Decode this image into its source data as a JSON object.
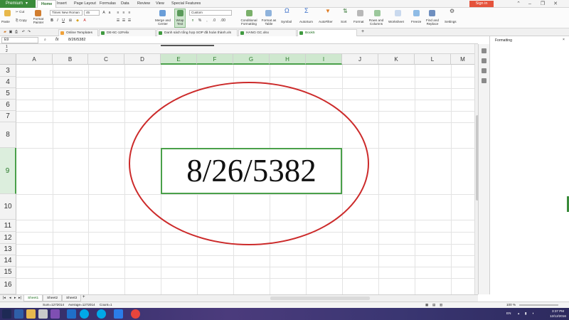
{
  "app": {
    "premium_label": "Premium",
    "menu_tabs": [
      "Home",
      "Insert",
      "Page Layout",
      "Formulas",
      "Data",
      "Review",
      "View",
      "Special Features"
    ],
    "signin_label": "Sign in"
  },
  "ribbon": {
    "cut": "Cut",
    "copy": "Copy",
    "paste": "Paste",
    "format_painter": "Format Painter",
    "font_name": "Times New Roman",
    "font_size": "45",
    "merge_center": "Merge and Center",
    "wrap_text": "Wrap Text",
    "number_format": "Custom",
    "conditional_formatting": "Conditional Formatting",
    "format_as_table": "Format as Table",
    "symbol": "Symbol",
    "autosum": "AutoSum",
    "autofilter": "AutoFilter",
    "sort": "Sort",
    "format": "Format",
    "rows_columns": "Rows and Columns",
    "worksheet": "Worksheet",
    "freeze": "Freeze",
    "find_replace": "Find and Replace",
    "settings": "Settings"
  },
  "doc_tabs": [
    {
      "label": "Online Templates",
      "type": "web"
    },
    {
      "label": "DE-6C-12Felix",
      "type": "sheet"
    },
    {
      "label": "Danh sách tổng hợp SOP đã hoàn thành.xls",
      "type": "sheet"
    },
    {
      "label": "HANG GC.xlsx",
      "type": "sheet"
    },
    {
      "label": "Book5",
      "type": "sheet"
    }
  ],
  "formula_bar": {
    "name_box": "E9",
    "fx": "fx",
    "value": "8/26/5382"
  },
  "grid": {
    "columns": [
      "A",
      "B",
      "C",
      "D",
      "E",
      "F",
      "G",
      "H",
      "I",
      "J",
      "K",
      "L",
      "M"
    ],
    "rows": [
      "3",
      "4",
      "5",
      "6",
      "7",
      "8",
      "9",
      "10",
      "11",
      "12",
      "13",
      "14",
      "15",
      "16"
    ],
    "selected_row": "9",
    "selected_cols": [
      "E",
      "F",
      "G",
      "H",
      "I"
    ],
    "cell_value": "8/26/5382",
    "outline_levels": [
      "1",
      "2"
    ]
  },
  "right_panel": {
    "title": "Formatting"
  },
  "sheets": [
    "Sheet1",
    "Sheet2",
    "Sheet3"
  ],
  "status_bar": {
    "sum": "Sum=1272014",
    "average": "Average=1272014",
    "count": "Count=1",
    "zoom": "100 %"
  },
  "taskbar": {
    "lang": "EN",
    "time": "3:37 PM",
    "date": "12/12/2016"
  },
  "colors": {
    "accent": "#3a8b3a",
    "annotation": "#cc2a2a",
    "signin": "#e5533c"
  }
}
